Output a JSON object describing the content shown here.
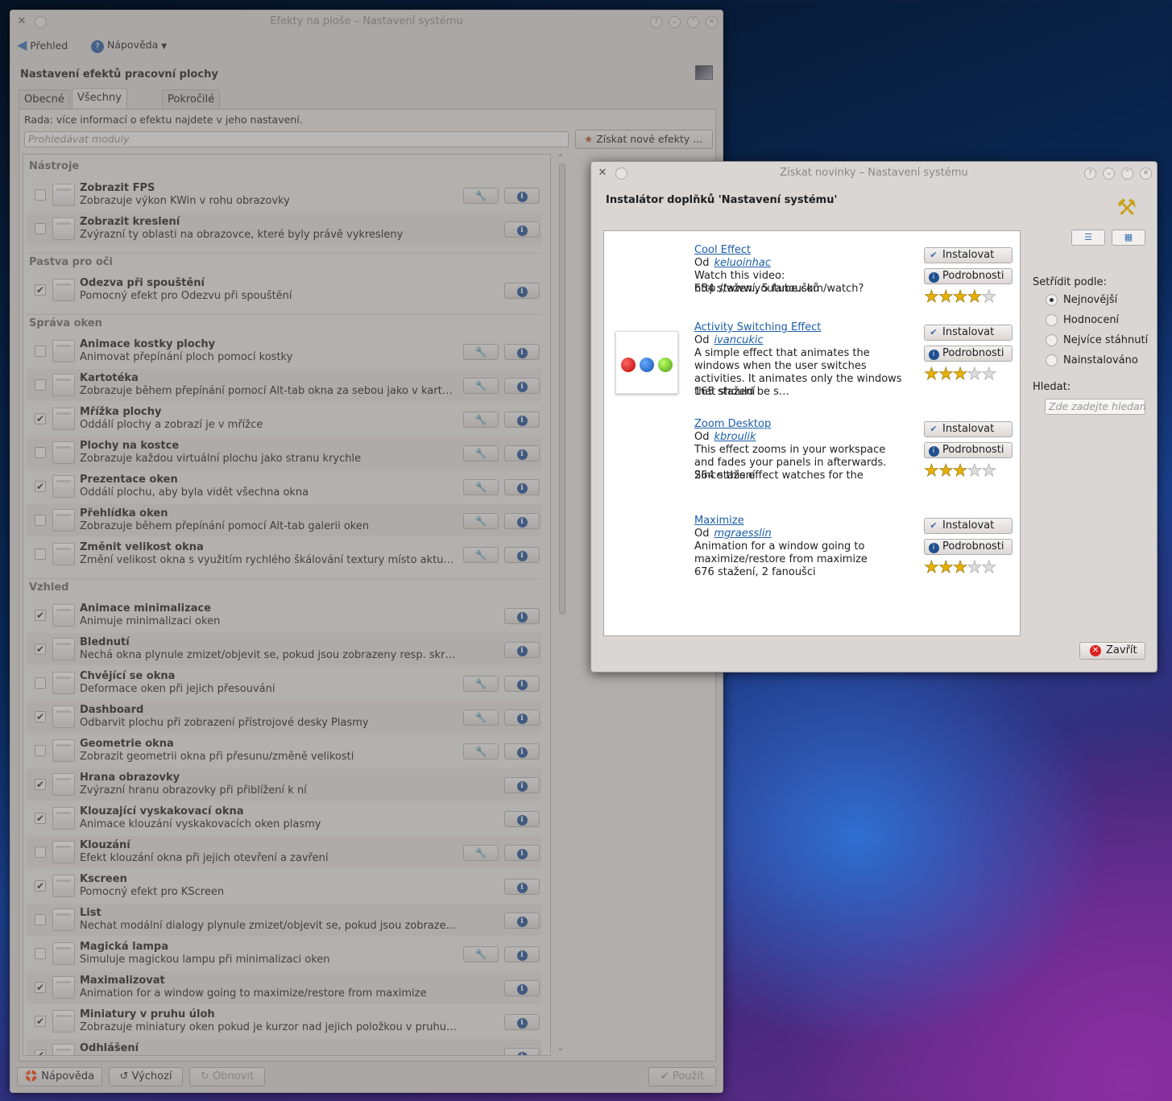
{
  "main_window": {
    "title": "Efekty na ploše – Nastavení systému",
    "toolbar": {
      "overview": "Přehled",
      "help": "Nápověda"
    },
    "heading": "Nastavení efektů pracovní plochy",
    "tabs": [
      "Obecné",
      "Všechny efekty",
      "Pokročilé"
    ],
    "active_tab": "Všechny efekty",
    "hint": "Rada: více informací o efektu najdete v jeho nastavení.",
    "search_placeholder": "Prohledávat moduly",
    "get_new": "Získat nové efekty ...",
    "categories": [
      {
        "name": "Nástroje",
        "items": [
          {
            "name": "Zobrazit FPS",
            "desc": "Zobrazuje výkon KWin v rohu obrazovky",
            "checked": false,
            "configurable": true
          },
          {
            "name": "Zobrazit kreslení",
            "desc": "Zvýrazní ty oblasti na obrazovce, které byly právě vykresleny",
            "checked": false,
            "configurable": false
          }
        ]
      },
      {
        "name": "Pastva pro oči",
        "items": [
          {
            "name": "Odezva při spouštění",
            "desc": "Pomocný efekt pro Odezvu při spouštění",
            "checked": true,
            "configurable": false
          }
        ]
      },
      {
        "name": "Správa oken",
        "items": [
          {
            "name": "Animace kostky plochy",
            "desc": "Animovat přepínání ploch pomocí kostky",
            "checked": false,
            "configurable": true
          },
          {
            "name": "Kartotéka",
            "desc": "Zobrazuje během přepínání pomocí Alt-tab okna za sebou jako v kartotéce",
            "checked": false,
            "configurable": true
          },
          {
            "name": "Mřížka plochy",
            "desc": "Oddálí plochy a zobrazí je v mřížce",
            "checked": true,
            "configurable": true
          },
          {
            "name": "Plochy na kostce",
            "desc": "Zobrazuje každou virtuální plochu jako stranu krychle",
            "checked": false,
            "configurable": true
          },
          {
            "name": "Prezentace oken",
            "desc": "Oddálí plochu, aby byla vidět všechna okna",
            "checked": true,
            "configurable": true
          },
          {
            "name": "Přehlídka oken",
            "desc": "Zobrazuje během přepínání pomocí Alt-tab galerii oken",
            "checked": false,
            "configurable": true
          },
          {
            "name": "Změnit velikost okna",
            "desc": "Změní velikost okna s využitím rychlého škálování textury místo aktualizac…",
            "checked": false,
            "configurable": true
          }
        ]
      },
      {
        "name": "Vzhled",
        "items": [
          {
            "name": "Animace minimalizace",
            "desc": "Animuje minimalizaci oken",
            "checked": true,
            "configurable": false
          },
          {
            "name": "Blednutí",
            "desc": "Nechá okna plynule zmizet/objevit se, pokud jsou zobrazeny resp. skryty",
            "checked": true,
            "configurable": false
          },
          {
            "name": "Chvějící se okna",
            "desc": "Deformace oken při jejich přesouvání",
            "checked": false,
            "configurable": true
          },
          {
            "name": "Dashboard",
            "desc": "Odbarvit plochu při zobrazení přístrojové desky Plasmy",
            "checked": true,
            "configurable": true
          },
          {
            "name": "Geometrie okna",
            "desc": "Zobrazit geometrii okna při přesunu/změně velikosti",
            "checked": false,
            "configurable": true
          },
          {
            "name": "Hrana obrazovky",
            "desc": "Zvýrazní hranu obrazovky při přiblížení k ní",
            "checked": true,
            "configurable": false
          },
          {
            "name": "Klouzající vyskakovací okna",
            "desc": "Animace klouzání vyskakovacích oken plasmy",
            "checked": true,
            "configurable": false
          },
          {
            "name": "Klouzání",
            "desc": "Efekt klouzání okna při jejich otevření a zavření",
            "checked": false,
            "configurable": true
          },
          {
            "name": "Kscreen",
            "desc": "Pomocný efekt pro KScreen",
            "checked": true,
            "configurable": false
          },
          {
            "name": "List",
            "desc": "Nechat modální dialogy plynule zmizet/objevit se, pokud jsou zobrazeny resp. skryty",
            "checked": false,
            "configurable": false
          },
          {
            "name": "Magická lampa",
            "desc": "Simuluje magickou lampu při minimalizaci oken",
            "checked": false,
            "configurable": true
          },
          {
            "name": "Maximalizovat",
            "desc": "Animation for a window going to maximize/restore from maximize",
            "checked": true,
            "configurable": false
          },
          {
            "name": "Miniatury v pruhu úloh",
            "desc": "Zobrazuje miniatury oken pokud je kurzor nad jejich položkou v pruhu úloh",
            "checked": true,
            "configurable": false
          },
          {
            "name": "Odhlášení",
            "desc": "",
            "checked": true,
            "configurable": false
          }
        ]
      }
    ],
    "bottom": {
      "help": "Nápověda",
      "defaults": "Výchozí",
      "reset": "Obnovit",
      "apply": "Použít"
    }
  },
  "dialog": {
    "title": "Získat novinky – Nastavení systému",
    "heading": "Instalátor doplňků 'Nastavení systému'",
    "install": "Instalovat",
    "details": "Podrobnosti",
    "by": "Od",
    "items": [
      {
        "name": "Cool Effect",
        "author": "keluoinhac",
        "desc": "Watch this video:\nhttp://www.youtube.com/watch?v=MYQnl)",
        "stats": "654 stažení, 5 fanoušků",
        "rating": 4,
        "has_thumb": false
      },
      {
        "name": "Activity Switching Effect",
        "author": "ivancukic",
        "desc": "A simple effect that animates the windows when the user switches activities. It animates only the windows that should be s…",
        "stats": "165 stažení",
        "rating": 3,
        "has_thumb": true
      },
      {
        "name": "Zoom Desktop",
        "author": "kbroulik",
        "desc": "This effect zooms in your workspace and fades your panels in afterwards. Since this effect watches for the _NET_WM_WIND…",
        "stats": "264 stažení",
        "rating": 3,
        "has_thumb": false
      },
      {
        "name": "Maximize",
        "author": "mgraesslin",
        "desc": "Animation for a window going to maximize/restore from maximize",
        "stats": "676 stažení, 2 fanoušci",
        "rating": 3,
        "has_thumb": false
      }
    ],
    "sort_label": "Setřídit podle:",
    "sort_options": [
      "Nejnovější",
      "Hodnocení",
      "Nejvíce stáhnutí",
      "Nainstalováno"
    ],
    "sort_selected": 0,
    "search_label": "Hledat:",
    "search_placeholder": "Zde zadejte hledaný text",
    "close": "Zavřít"
  }
}
